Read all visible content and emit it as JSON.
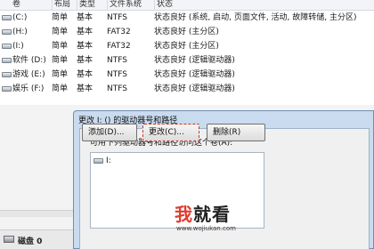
{
  "columns": [
    "卷",
    "布局",
    "类型",
    "文件系统",
    "状态"
  ],
  "volumes": [
    {
      "name": "(C:)",
      "layout": "简单",
      "type": "基本",
      "fs": "NTFS",
      "status": "状态良好 (系统, 启动, 页面文件, 活动, 故障转储, 主分区)"
    },
    {
      "name": "(H:)",
      "layout": "简单",
      "type": "基本",
      "fs": "FAT32",
      "status": "状态良好 (主分区)"
    },
    {
      "name": "(I:)",
      "layout": "简单",
      "type": "基本",
      "fs": "FAT32",
      "status": "状态良好 (主分区)"
    },
    {
      "name": "软件 (D:)",
      "layout": "简单",
      "type": "基本",
      "fs": "NTFS",
      "status": "状态良好 (逻辑驱动器)"
    },
    {
      "name": "游戏 (E:)",
      "layout": "简单",
      "type": "基本",
      "fs": "NTFS",
      "status": "状态良好 (逻辑驱动器)"
    },
    {
      "name": "娱乐 (F:)",
      "layout": "简单",
      "type": "基本",
      "fs": "NTFS",
      "status": "状态良好 (逻辑驱动器)"
    }
  ],
  "disk": {
    "label": "磁盘 0"
  },
  "dialog": {
    "title": "更改 I: () 的驱动器号和路径",
    "prompt": "可用下列驱动器号和路径访问这个卷(A):",
    "list_items": [
      "I:"
    ],
    "buttons": {
      "add": "添加(D)...",
      "change": "更改(C)...",
      "remove": "删除(R)"
    }
  },
  "watermark": {
    "big_red": "我",
    "big_dark": "就看",
    "url": "www.wojiukan.com"
  }
}
